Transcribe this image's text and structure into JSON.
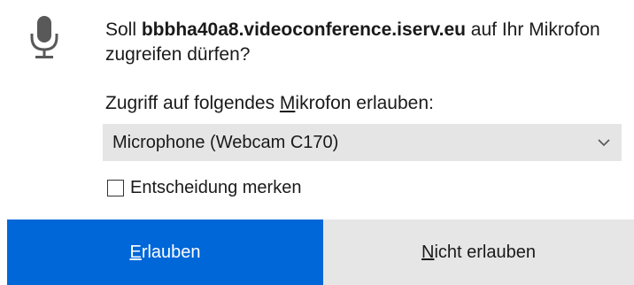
{
  "prompt": {
    "prefix": "Soll ",
    "host": "bbbha40a8.videoconference.iserv.eu",
    "suffix": " auf Ihr Mikrofon zugreifen dürfen?"
  },
  "device_label": {
    "part1": "Zugriff auf folgendes ",
    "accel": "M",
    "part2": "ikrofon erlauben:"
  },
  "device_select": {
    "selected": "Microphone (Webcam C170)"
  },
  "remember": {
    "label": "Entscheidung merken",
    "checked": false
  },
  "buttons": {
    "allow": {
      "accel": "E",
      "rest": "rlauben"
    },
    "deny": {
      "accel": "N",
      "rest": "icht erlauben"
    }
  },
  "colors": {
    "primary": "#0067d8",
    "secondary": "#e6e6e6",
    "select_bg": "#e5e5e5",
    "icon": "#595959"
  },
  "icons": {
    "mic": "microphone-icon",
    "chevron": "chevron-down-icon",
    "checkbox": "checkbox-unchecked"
  }
}
